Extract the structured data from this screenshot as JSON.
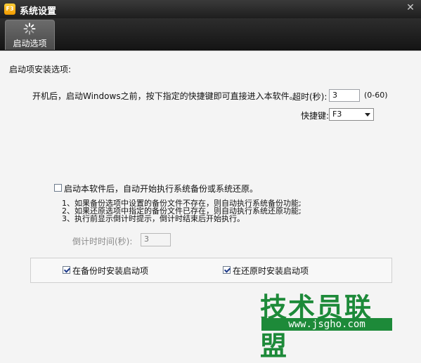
{
  "window": {
    "title": "系统设置",
    "close_glyph": "✕"
  },
  "tabs": [
    {
      "label": "启动选项",
      "icon": "spinner-icon",
      "selected": true
    }
  ],
  "section": {
    "heading": "启动项安装选项:"
  },
  "description": "开机后，启动Windows之前，按下指定的快捷键即可直接进入本软件。",
  "timeout": {
    "label": "超时(秒):",
    "value": "3",
    "range": "(0-60)"
  },
  "hotkey": {
    "label": "快捷键:",
    "selected": "F3"
  },
  "auto_backup": {
    "label": "启动本软件后，自动开始执行系统备份或系统还原。",
    "checked": false,
    "notes": [
      "1、如果备份选项中设置的备份文件不存在，则自动执行系统备份功能;",
      "2、如果还原选项中指定的备份文件已存在，则自动执行系统还原功能;",
      "3、执行前显示倒计时提示，倒计时结束后开始执行。"
    ],
    "countdown_label": "倒计时时间(秒):",
    "countdown_value": "3"
  },
  "install_options": {
    "on_backup": {
      "label": "在备份时安装启动项",
      "checked": true
    },
    "on_restore": {
      "label": "在还原时安装启动项",
      "checked": true
    }
  },
  "watermark": {
    "brand": "技术员联盟",
    "url": "www.jsgho.com"
  },
  "colors": {
    "titlebar": "#2b2b2b",
    "watermark": "#1d8a39"
  }
}
